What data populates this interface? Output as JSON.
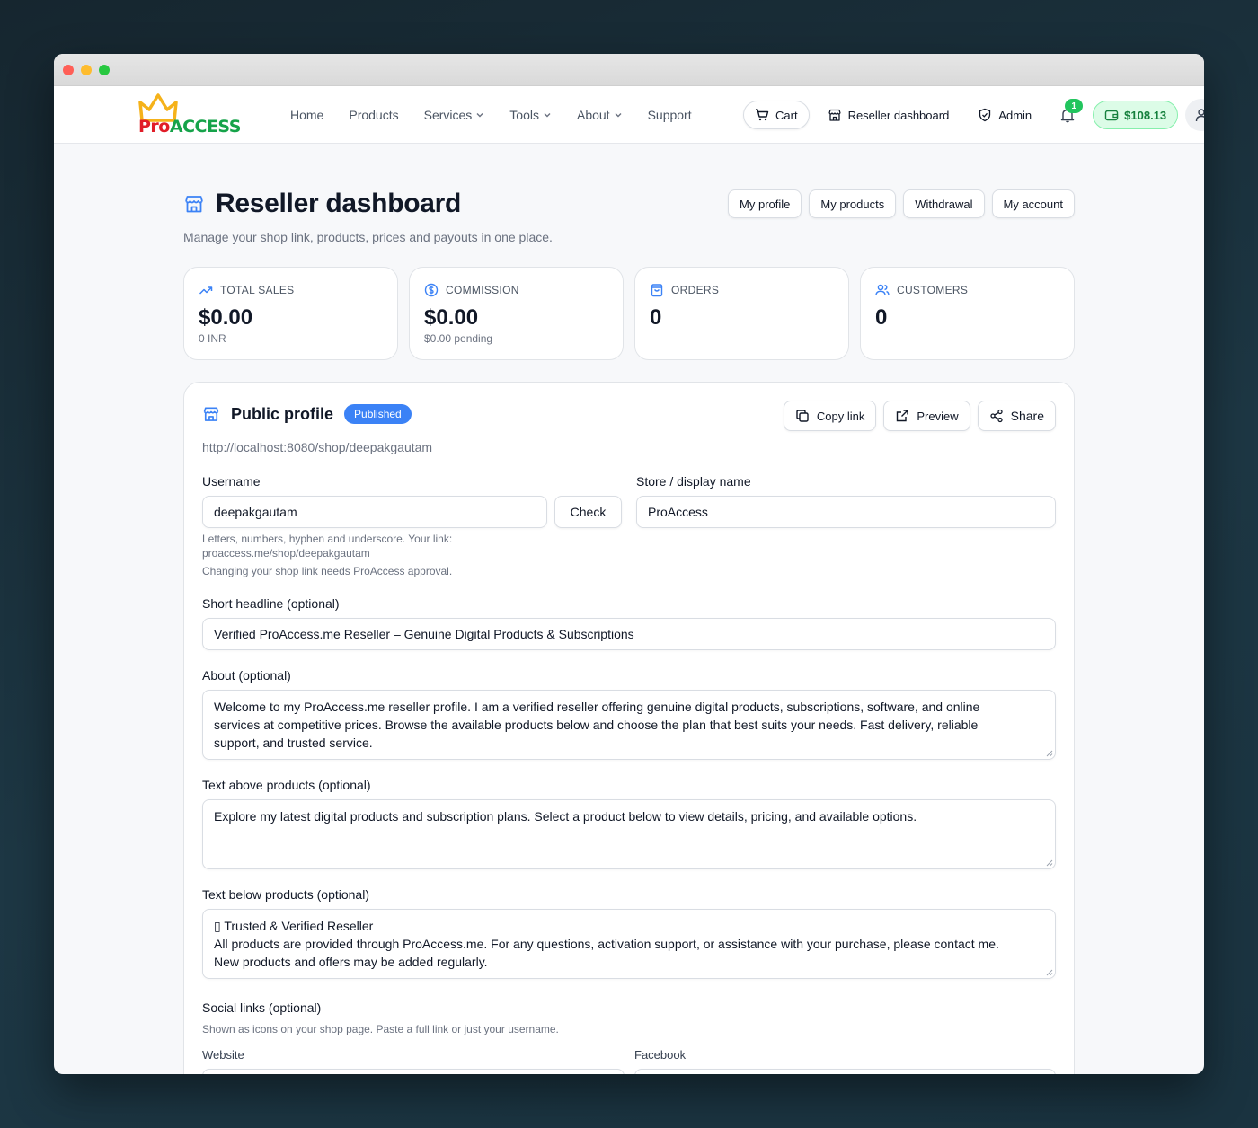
{
  "brand": {
    "logo_pro": "Pro",
    "logo_access": "ACCESS"
  },
  "nav": {
    "links": [
      "Home",
      "Products",
      "Services",
      "Tools",
      "About",
      "Support"
    ],
    "cart_label": "Cart",
    "reseller_label": "Reseller dashboard",
    "admin_label": "Admin",
    "notification_count": "1",
    "wallet_balance": "$108.13"
  },
  "page": {
    "title": "Reseller dashboard",
    "subtitle": "Manage your shop link, products, prices and payouts in one place.",
    "actions": [
      "My profile",
      "My products",
      "Withdrawal",
      "My account"
    ]
  },
  "stats": [
    {
      "label": "TOTAL SALES",
      "value": "$0.00",
      "note": "0 INR",
      "icon": "trending-up-icon"
    },
    {
      "label": "COMMISSION",
      "value": "$0.00",
      "note": "$0.00 pending",
      "icon": "dollar-circle-icon"
    },
    {
      "label": "ORDERS",
      "value": "0",
      "note": "",
      "icon": "shopping-bag-icon"
    },
    {
      "label": "CUSTOMERS",
      "value": "0",
      "note": "",
      "icon": "users-icon"
    }
  ],
  "profile": {
    "title": "Public profile",
    "status": "Published",
    "copy_label": "Copy link",
    "preview_label": "Preview",
    "share_label": "Share",
    "url": "http://localhost:8080/shop/deepakgautam",
    "username_label": "Username",
    "username_value": "deepakgautam",
    "check_label": "Check",
    "username_hint_1": "Letters, numbers, hyphen and underscore. Your link:",
    "username_hint_2": "proaccess.me/shop/deepakgautam",
    "username_hint_3": "Changing your shop link needs ProAccess approval.",
    "store_label": "Store / display name",
    "store_value": "ProAccess",
    "headline_label": "Short headline (optional)",
    "headline_value": "Verified ProAccess.me Reseller – Genuine Digital Products & Subscriptions",
    "about_label": "About (optional)",
    "about_lines": [
      "Welcome to my ProAccess.me reseller profile. I am a verified reseller offering genuine digital products, subscriptions, software, and online",
      "services at competitive prices. Browse the available products below and choose the plan that best suits your needs. Fast delivery, reliable",
      "support, and trusted service."
    ],
    "above_label": "Text above products (optional)",
    "above_lines": [
      "Explore my latest digital products and subscription plans. Select a product below to view details, pricing, and available options."
    ],
    "below_label": "Text below products (optional)",
    "below_lines": [
      "▯ Trusted & Verified Reseller",
      "All products are provided through ProAccess.me. For any questions, activation support, or assistance with your purchase, please contact me.",
      "New products and offers may be added regularly."
    ],
    "social_label": "Social links (optional)",
    "social_hint": "Shown as icons on your shop page. Paste a full link or just your username.",
    "website_label": "Website",
    "facebook_label": "Facebook"
  }
}
